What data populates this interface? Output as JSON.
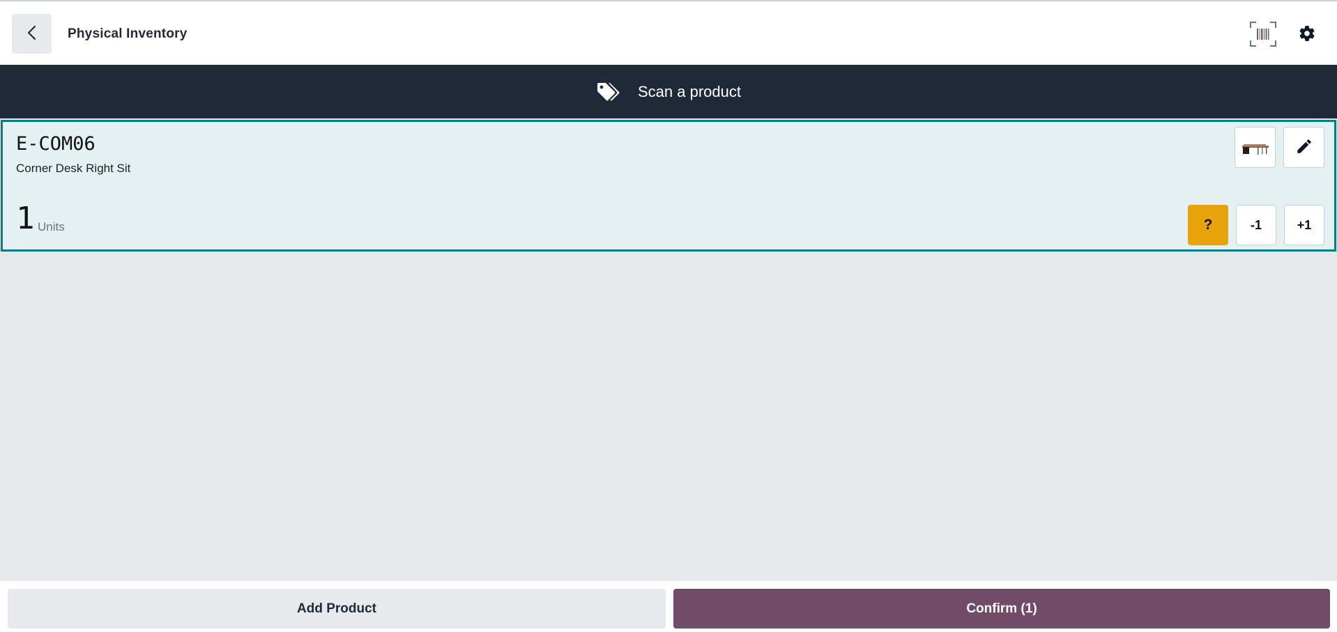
{
  "header": {
    "title": "Physical Inventory",
    "back_icon": "chevron-left-icon",
    "barcode_icon": "barcode-scanner-icon",
    "settings_icon": "gear-icon"
  },
  "banner": {
    "icon": "tags-icon",
    "text": "Scan a product"
  },
  "line": {
    "sku": "E-COM06",
    "product_name": "Corner Desk Right Sit",
    "quantity": "1",
    "uom": "Units",
    "question_label": "?",
    "minus_label": "-1",
    "plus_label": "+1",
    "thumbnail_icon": "desk-image",
    "edit_icon": "pencil-icon",
    "question_color": "#e8a20c"
  },
  "footer": {
    "add_product_label": "Add Product",
    "confirm_label": "Confirm (1)",
    "confirm_color": "#714b67"
  },
  "colors": {
    "banner_bg": "#1f2937",
    "selected_border": "#017e84",
    "selected_bg": "#e4f0f2",
    "page_bg": "#e7e9ed"
  }
}
